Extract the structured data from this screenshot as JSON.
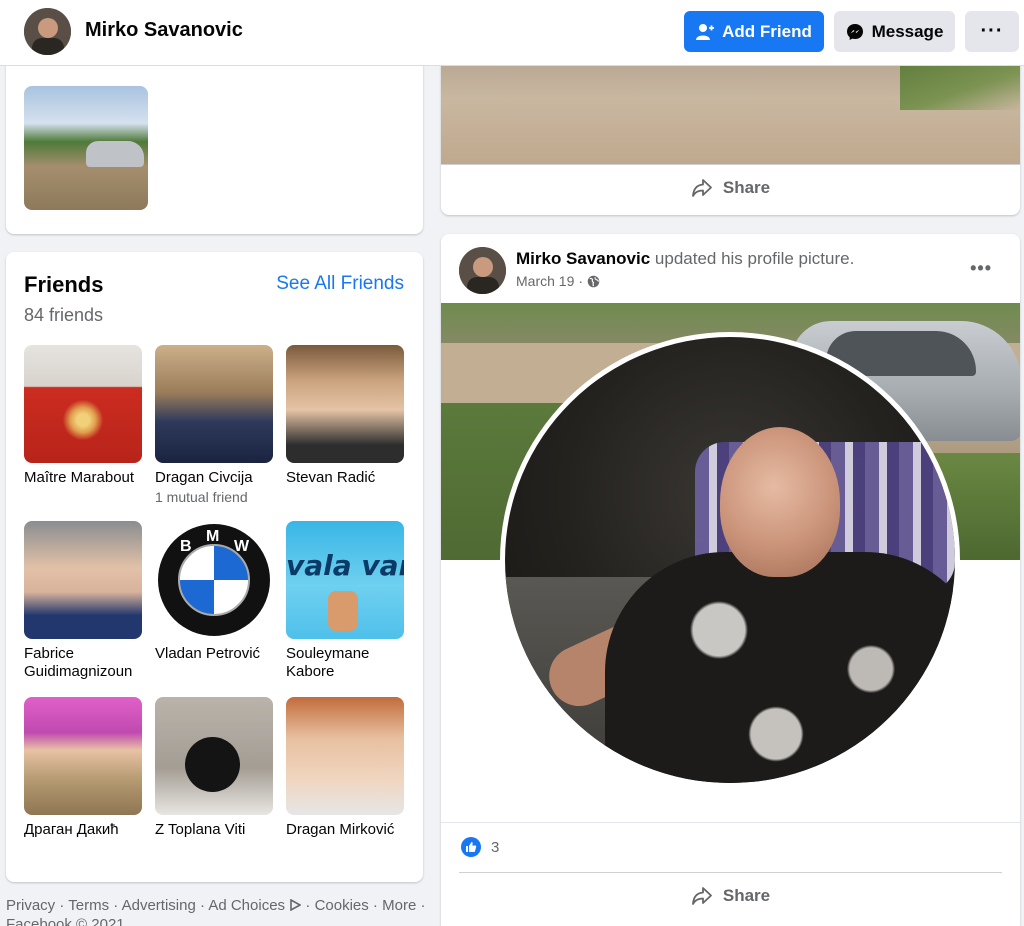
{
  "header": {
    "profile_name": "Mirko Savanovic",
    "add_friend_label": "Add Friend",
    "message_label": "Message",
    "more_label": "···"
  },
  "photos": {
    "thumb_alt": "Photo"
  },
  "friends": {
    "title": "Friends",
    "count_text": "84 friends",
    "see_all_label": "See All Friends",
    "items": [
      {
        "name": "Maître Marabout",
        "mutual": ""
      },
      {
        "name": "Dragan Civcija",
        "mutual": "1 mutual friend"
      },
      {
        "name": "Stevan Radić",
        "mutual": ""
      },
      {
        "name": "Fabrice Guidimagnizoun",
        "mutual": ""
      },
      {
        "name": "Vladan Petrović",
        "mutual": ""
      },
      {
        "name": "Souleymane Kabore",
        "mutual": ""
      },
      {
        "name": "Драган Дакић",
        "mutual": ""
      },
      {
        "name": "Z Toplana Viti",
        "mutual": ""
      },
      {
        "name": "Dragan Mirković",
        "mutual": ""
      }
    ],
    "bmw_letters": [
      "B",
      "M",
      "W"
    ],
    "vala_text": "vala van"
  },
  "footer": {
    "links": [
      "Privacy",
      "Terms",
      "Advertising",
      "Ad Choices",
      "Cookies",
      "More"
    ],
    "copyright": "Facebook © 2021"
  },
  "post1": {
    "share_label": "Share"
  },
  "post2": {
    "author": "Mirko Savanovic",
    "action_text": "updated his profile picture.",
    "date": "March 19",
    "separator": "·",
    "options_label": "•••",
    "like_count": "3",
    "share_label": "Share"
  },
  "colors": {
    "brand": "#1877f2",
    "background": "#f0f2f5",
    "secondary_text": "#65676b"
  },
  "icons": {
    "add_friend": "person-plus-icon",
    "message": "messenger-icon",
    "share": "share-arrow-icon",
    "privacy": "globe-icon",
    "like": "thumbs-up-icon",
    "ad_choices": "ad-choices-icon"
  }
}
